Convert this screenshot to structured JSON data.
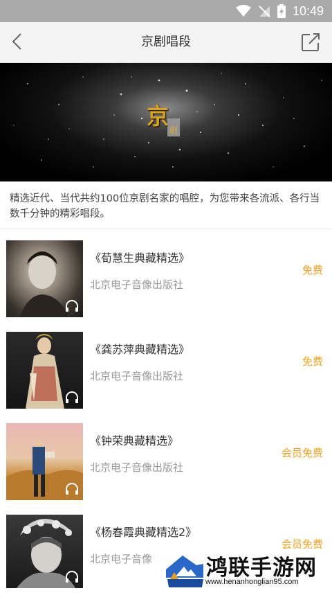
{
  "status_bar": {
    "time": "10:49"
  },
  "nav": {
    "title": "京剧唱段"
  },
  "banner": {
    "logo_main": "京",
    "logo_sub": "剧"
  },
  "description": "精选近代、当代共约100位京剧名家的唱腔，为您带来各流派、各行当数千分钟的精彩唱段。",
  "items": [
    {
      "title": "《荀慧生典藏精选》",
      "publisher": "北京电子音像出版社",
      "price": "免费"
    },
    {
      "title": "《龚苏萍典藏精选》",
      "publisher": "北京电子音像出版社",
      "price": "免费"
    },
    {
      "title": "《钟荣典藏精选》",
      "publisher": "北京电子音像出版社",
      "price": "会员免费"
    },
    {
      "title": "《杨春霞典藏精选2》",
      "publisher": "北京电子音像出版社",
      "price": "会员免费"
    }
  ],
  "watermark": {
    "title": "鸿联手游网",
    "url": "www.henanhonglian95.com"
  },
  "colors": {
    "accent": "#f0a020",
    "nav_bg": "#f3f3f3",
    "status_bg": "#aaaaaa"
  }
}
